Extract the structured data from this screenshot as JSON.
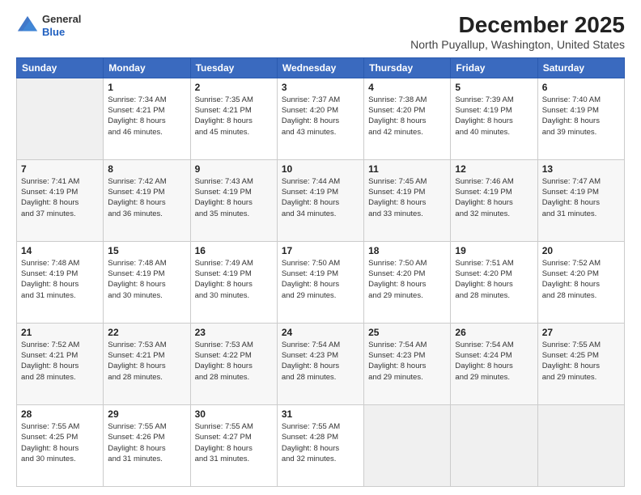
{
  "logo": {
    "general": "General",
    "blue": "Blue"
  },
  "title": "December 2025",
  "location": "North Puyallup, Washington, United States",
  "weekdays": [
    "Sunday",
    "Monday",
    "Tuesday",
    "Wednesday",
    "Thursday",
    "Friday",
    "Saturday"
  ],
  "weeks": [
    [
      {
        "day": "",
        "sunrise": "",
        "sunset": "",
        "daylight": "",
        "empty": true
      },
      {
        "day": "1",
        "sunrise": "Sunrise: 7:34 AM",
        "sunset": "Sunset: 4:21 PM",
        "daylight": "Daylight: 8 hours and 46 minutes."
      },
      {
        "day": "2",
        "sunrise": "Sunrise: 7:35 AM",
        "sunset": "Sunset: 4:21 PM",
        "daylight": "Daylight: 8 hours and 45 minutes."
      },
      {
        "day": "3",
        "sunrise": "Sunrise: 7:37 AM",
        "sunset": "Sunset: 4:20 PM",
        "daylight": "Daylight: 8 hours and 43 minutes."
      },
      {
        "day": "4",
        "sunrise": "Sunrise: 7:38 AM",
        "sunset": "Sunset: 4:20 PM",
        "daylight": "Daylight: 8 hours and 42 minutes."
      },
      {
        "day": "5",
        "sunrise": "Sunrise: 7:39 AM",
        "sunset": "Sunset: 4:19 PM",
        "daylight": "Daylight: 8 hours and 40 minutes."
      },
      {
        "day": "6",
        "sunrise": "Sunrise: 7:40 AM",
        "sunset": "Sunset: 4:19 PM",
        "daylight": "Daylight: 8 hours and 39 minutes."
      }
    ],
    [
      {
        "day": "7",
        "sunrise": "Sunrise: 7:41 AM",
        "sunset": "Sunset: 4:19 PM",
        "daylight": "Daylight: 8 hours and 37 minutes."
      },
      {
        "day": "8",
        "sunrise": "Sunrise: 7:42 AM",
        "sunset": "Sunset: 4:19 PM",
        "daylight": "Daylight: 8 hours and 36 minutes."
      },
      {
        "day": "9",
        "sunrise": "Sunrise: 7:43 AM",
        "sunset": "Sunset: 4:19 PM",
        "daylight": "Daylight: 8 hours and 35 minutes."
      },
      {
        "day": "10",
        "sunrise": "Sunrise: 7:44 AM",
        "sunset": "Sunset: 4:19 PM",
        "daylight": "Daylight: 8 hours and 34 minutes."
      },
      {
        "day": "11",
        "sunrise": "Sunrise: 7:45 AM",
        "sunset": "Sunset: 4:19 PM",
        "daylight": "Daylight: 8 hours and 33 minutes."
      },
      {
        "day": "12",
        "sunrise": "Sunrise: 7:46 AM",
        "sunset": "Sunset: 4:19 PM",
        "daylight": "Daylight: 8 hours and 32 minutes."
      },
      {
        "day": "13",
        "sunrise": "Sunrise: 7:47 AM",
        "sunset": "Sunset: 4:19 PM",
        "daylight": "Daylight: 8 hours and 31 minutes."
      }
    ],
    [
      {
        "day": "14",
        "sunrise": "Sunrise: 7:48 AM",
        "sunset": "Sunset: 4:19 PM",
        "daylight": "Daylight: 8 hours and 31 minutes."
      },
      {
        "day": "15",
        "sunrise": "Sunrise: 7:48 AM",
        "sunset": "Sunset: 4:19 PM",
        "daylight": "Daylight: 8 hours and 30 minutes."
      },
      {
        "day": "16",
        "sunrise": "Sunrise: 7:49 AM",
        "sunset": "Sunset: 4:19 PM",
        "daylight": "Daylight: 8 hours and 30 minutes."
      },
      {
        "day": "17",
        "sunrise": "Sunrise: 7:50 AM",
        "sunset": "Sunset: 4:19 PM",
        "daylight": "Daylight: 8 hours and 29 minutes."
      },
      {
        "day": "18",
        "sunrise": "Sunrise: 7:50 AM",
        "sunset": "Sunset: 4:20 PM",
        "daylight": "Daylight: 8 hours and 29 minutes."
      },
      {
        "day": "19",
        "sunrise": "Sunrise: 7:51 AM",
        "sunset": "Sunset: 4:20 PM",
        "daylight": "Daylight: 8 hours and 28 minutes."
      },
      {
        "day": "20",
        "sunrise": "Sunrise: 7:52 AM",
        "sunset": "Sunset: 4:20 PM",
        "daylight": "Daylight: 8 hours and 28 minutes."
      }
    ],
    [
      {
        "day": "21",
        "sunrise": "Sunrise: 7:52 AM",
        "sunset": "Sunset: 4:21 PM",
        "daylight": "Daylight: 8 hours and 28 minutes."
      },
      {
        "day": "22",
        "sunrise": "Sunrise: 7:53 AM",
        "sunset": "Sunset: 4:21 PM",
        "daylight": "Daylight: 8 hours and 28 minutes."
      },
      {
        "day": "23",
        "sunrise": "Sunrise: 7:53 AM",
        "sunset": "Sunset: 4:22 PM",
        "daylight": "Daylight: 8 hours and 28 minutes."
      },
      {
        "day": "24",
        "sunrise": "Sunrise: 7:54 AM",
        "sunset": "Sunset: 4:23 PM",
        "daylight": "Daylight: 8 hours and 28 minutes."
      },
      {
        "day": "25",
        "sunrise": "Sunrise: 7:54 AM",
        "sunset": "Sunset: 4:23 PM",
        "daylight": "Daylight: 8 hours and 29 minutes."
      },
      {
        "day": "26",
        "sunrise": "Sunrise: 7:54 AM",
        "sunset": "Sunset: 4:24 PM",
        "daylight": "Daylight: 8 hours and 29 minutes."
      },
      {
        "day": "27",
        "sunrise": "Sunrise: 7:55 AM",
        "sunset": "Sunset: 4:25 PM",
        "daylight": "Daylight: 8 hours and 29 minutes."
      }
    ],
    [
      {
        "day": "28",
        "sunrise": "Sunrise: 7:55 AM",
        "sunset": "Sunset: 4:25 PM",
        "daylight": "Daylight: 8 hours and 30 minutes."
      },
      {
        "day": "29",
        "sunrise": "Sunrise: 7:55 AM",
        "sunset": "Sunset: 4:26 PM",
        "daylight": "Daylight: 8 hours and 31 minutes."
      },
      {
        "day": "30",
        "sunrise": "Sunrise: 7:55 AM",
        "sunset": "Sunset: 4:27 PM",
        "daylight": "Daylight: 8 hours and 31 minutes."
      },
      {
        "day": "31",
        "sunrise": "Sunrise: 7:55 AM",
        "sunset": "Sunset: 4:28 PM",
        "daylight": "Daylight: 8 hours and 32 minutes."
      },
      {
        "day": "",
        "sunrise": "",
        "sunset": "",
        "daylight": "",
        "empty": true
      },
      {
        "day": "",
        "sunrise": "",
        "sunset": "",
        "daylight": "",
        "empty": true
      },
      {
        "day": "",
        "sunrise": "",
        "sunset": "",
        "daylight": "",
        "empty": true
      }
    ]
  ]
}
